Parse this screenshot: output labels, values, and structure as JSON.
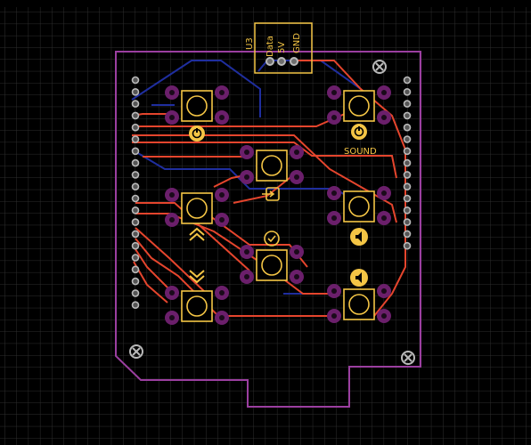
{
  "toolbar": {
    "buttons": [
      "pointer-icon",
      "route-icon",
      "via-icon",
      "pad-icon",
      "text-icon",
      "grid-icon",
      "ruler-icon",
      "zoom-icon"
    ]
  },
  "board": {
    "connector_ref": "U3",
    "pins": [
      "Data",
      "5V",
      "GND"
    ],
    "silk_labels": {
      "sound": "SOUND"
    }
  },
  "colors": {
    "background": "#000000",
    "grid": "#2e2e2e",
    "outline": "#9b3fa0",
    "top_trace": "#e5452d",
    "bottom_trace": "#1f2e9e",
    "silkscreen": "#f4c545",
    "pad": "#6b1f6b",
    "via_ring": "#b9b9b9"
  },
  "buttons": [
    {
      "id": "power",
      "icon": "power-icon"
    },
    {
      "id": "sound",
      "icon": "power-icon"
    },
    {
      "id": "enter",
      "icon": "input-icon"
    },
    {
      "id": "up",
      "icon": "chevron-up-icon"
    },
    {
      "id": "ok",
      "icon": "check-circle-icon"
    },
    {
      "id": "vol-left-1",
      "icon": "speaker-icon"
    },
    {
      "id": "down",
      "icon": "chevron-down-icon"
    },
    {
      "id": "vol-left-2",
      "icon": "speaker-icon"
    }
  ]
}
